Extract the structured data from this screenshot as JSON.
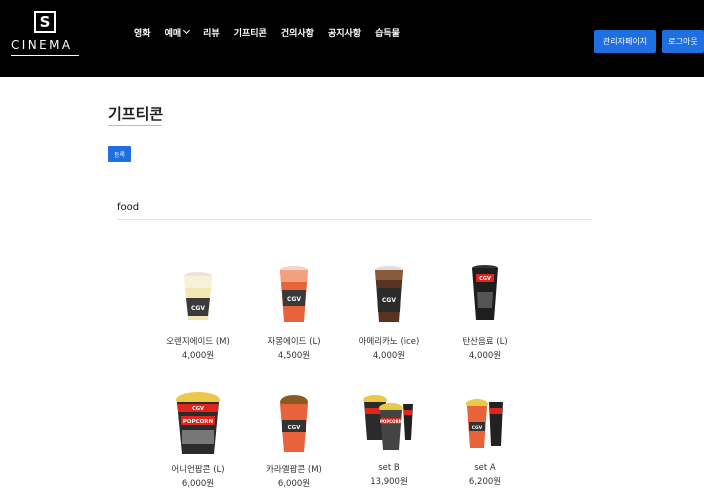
{
  "header": {
    "logo_letter": "S",
    "logo_word": "CINEMA",
    "nav": [
      "영화",
      "예매",
      "리뷰",
      "기프티콘",
      "건의사항",
      "공지사항",
      "습득물"
    ],
    "admin_button": "관리자페이지",
    "logout_button": "로그아웃"
  },
  "main": {
    "title": "기프티콘",
    "register_button": "등록",
    "section": "food",
    "products": [
      {
        "name": "오렌지에이드 (M)",
        "price": "4,000원",
        "icon": "orange-ade-cup-icon"
      },
      {
        "name": "자몽에이드 (L)",
        "price": "4,500원",
        "icon": "grapefruit-ade-cup-icon"
      },
      {
        "name": "아메리카노 (ice)",
        "price": "4,000원",
        "icon": "iced-americano-cup-icon"
      },
      {
        "name": "탄산음료 (L)",
        "price": "4,000원",
        "icon": "soda-cup-icon"
      },
      {
        "name": "어니언팝콘 (L)",
        "price": "6,000원",
        "icon": "onion-popcorn-icon"
      },
      {
        "name": "카라멜팝콘 (M)",
        "price": "6,000원",
        "icon": "caramel-popcorn-icon"
      },
      {
        "name": "set B",
        "price": "13,900원",
        "icon": "set-b-combo-icon"
      },
      {
        "name": "set A",
        "price": "6,200원",
        "icon": "set-a-combo-icon"
      }
    ]
  },
  "colors": {
    "header_bg": "#000000",
    "accent_blue": "#1f6fe0",
    "cgv_red": "#e0261c"
  }
}
